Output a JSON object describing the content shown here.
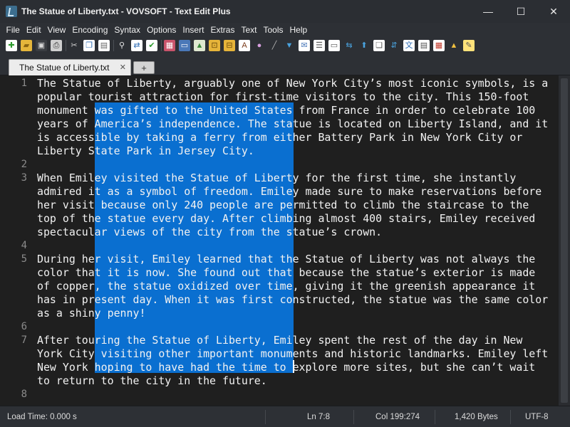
{
  "window": {
    "title": "The Statue of Liberty.txt - VOVSOFT - Text Edit Plus",
    "controls": {
      "minimize": "—",
      "maximize": "☐",
      "close": "✕"
    }
  },
  "menu": {
    "items": [
      "File",
      "Edit",
      "View",
      "Encoding",
      "Syntax",
      "Options",
      "Insert",
      "Extras",
      "Text",
      "Tools",
      "Help"
    ]
  },
  "toolbar": {
    "icons": [
      {
        "name": "new-file-icon",
        "glyph": "✚",
        "bg": "#ffffff",
        "fg": "#2e9b2e"
      },
      {
        "name": "open-folder-icon",
        "glyph": "▰",
        "bg": "#e5b63b",
        "fg": "#8a6410"
      },
      {
        "name": "save-icon",
        "glyph": "▣",
        "bg": "#3a3d42",
        "fg": "#d8d8d8"
      },
      {
        "name": "print-icon",
        "glyph": "⎙",
        "bg": "#cfcfcf",
        "fg": "#333333"
      },
      {
        "sep": true
      },
      {
        "name": "cut-icon",
        "glyph": "✂",
        "bg": "transparent",
        "fg": "#d0d0d0"
      },
      {
        "name": "copy-icon",
        "glyph": "❐",
        "bg": "#ffffff",
        "fg": "#2f6db5"
      },
      {
        "name": "paste-icon",
        "glyph": "▤",
        "bg": "#ffffff",
        "fg": "#6a6a6a"
      },
      {
        "sep": true
      },
      {
        "name": "find-icon",
        "glyph": "⚲",
        "bg": "transparent",
        "fg": "#e8e8e8"
      },
      {
        "name": "replace-icon",
        "glyph": "⇄",
        "bg": "#ffffff",
        "fg": "#2f6db5"
      },
      {
        "name": "check-icon",
        "glyph": "✔",
        "bg": "#ffffff",
        "fg": "#2e9b2e"
      },
      {
        "sep": true
      },
      {
        "name": "bookmark-icon",
        "glyph": "▦",
        "bg": "#c9546b",
        "fg": "#ffffff"
      },
      {
        "name": "monitor-icon",
        "glyph": "▭",
        "bg": "#4a78b8",
        "fg": "#ffffff"
      },
      {
        "name": "image-icon",
        "glyph": "▲",
        "bg": "#dfe8d0",
        "fg": "#3c8a3c"
      },
      {
        "name": "lock-icon",
        "glyph": "⊡",
        "bg": "#e6b43a",
        "fg": "#6b4a0a"
      },
      {
        "name": "unlock-icon",
        "glyph": "⊟",
        "bg": "#e6b43a",
        "fg": "#6b4a0a"
      },
      {
        "name": "font-icon",
        "glyph": "A",
        "bg": "#ffffff",
        "fg": "#7a3a1a"
      },
      {
        "name": "color-wheel-icon",
        "glyph": "●",
        "bg": "transparent",
        "fg": "#d9a0e0"
      },
      {
        "name": "picker-icon",
        "glyph": "╱",
        "bg": "transparent",
        "fg": "#b0b0b0"
      },
      {
        "name": "filter-icon",
        "glyph": "▼",
        "bg": "transparent",
        "fg": "#4aa3df"
      },
      {
        "name": "mail-icon",
        "glyph": "✉",
        "bg": "#ffffff",
        "fg": "#4a78b8"
      },
      {
        "name": "list-icon",
        "glyph": "☰",
        "bg": "#ffffff",
        "fg": "#555555"
      },
      {
        "name": "keyboard-icon",
        "glyph": "▭",
        "bg": "#ffffff",
        "fg": "#555555"
      },
      {
        "name": "swap-icon",
        "glyph": "⇆",
        "bg": "transparent",
        "fg": "#4aa3df"
      },
      {
        "name": "upload-icon",
        "glyph": "⬆",
        "bg": "transparent",
        "fg": "#4aa3df"
      },
      {
        "name": "copy-doc-icon",
        "glyph": "❏",
        "bg": "#ffffff",
        "fg": "#555555"
      },
      {
        "name": "sort-az-icon",
        "glyph": "⇵",
        "bg": "transparent",
        "fg": "#4aa3df"
      },
      {
        "name": "translate-icon",
        "glyph": "文",
        "bg": "#ffffff",
        "fg": "#2f6db5"
      },
      {
        "name": "table-icon",
        "glyph": "▤",
        "bg": "#ffffff",
        "fg": "#555555"
      },
      {
        "name": "calendar-icon",
        "glyph": "▦",
        "bg": "#ffffff",
        "fg": "#c0392b"
      },
      {
        "name": "warning-icon",
        "glyph": "▲",
        "bg": "transparent",
        "fg": "#f0c040"
      },
      {
        "name": "edit-note-icon",
        "glyph": "✎",
        "bg": "#ffe27a",
        "fg": "#555555"
      }
    ]
  },
  "tabs": {
    "active_label": "The Statue of Liberty.txt",
    "close_glyph": "✕",
    "add_glyph": "+"
  },
  "editor": {
    "line_numbers": [
      "1",
      "2",
      "3",
      "4",
      "5",
      "6",
      "7",
      "8"
    ],
    "visual_lines": [
      {
        "num": "1",
        "text": "The Statue of Liberty, arguably one of New York City’s most iconic symbols, is a"
      },
      {
        "num": "",
        "text": "popular tourist attraction for first-time visitors to the city. This 150-foot"
      },
      {
        "num": "",
        "text": "monument was gifted to the United States from France in order to celebrate 100"
      },
      {
        "num": "",
        "text": "years of America’s independence. The statue is located on Liberty Island, and it"
      },
      {
        "num": "",
        "text": "is accessible by taking a ferry from either Battery Park in New York City or"
      },
      {
        "num": "",
        "text": "Liberty State Park in Jersey City."
      },
      {
        "num": "2",
        "text": ""
      },
      {
        "num": "3",
        "text": "When Emiley visited the Statue of Liberty for the first time, she instantly"
      },
      {
        "num": "",
        "text": "admired it as a symbol of freedom. Emiley made sure to make reservations before"
      },
      {
        "num": "",
        "text": "her visit because only 240 people are permitted to climb the staircase to the"
      },
      {
        "num": "",
        "text": "top of the statue every day. After climbing almost 400 stairs, Emiley received"
      },
      {
        "num": "",
        "text": "spectacular views of the city from the statue’s crown."
      },
      {
        "num": "4",
        "text": ""
      },
      {
        "num": "5",
        "text": "During her visit, Emiley learned that the Statue of Liberty was not always the"
      },
      {
        "num": "",
        "text": "color that it is now. She found out that because the statue’s exterior is made"
      },
      {
        "num": "",
        "text": "of copper, the statue oxidized over time, giving it the greenish appearance it"
      },
      {
        "num": "",
        "text": "has in present day. When it was first constructed, the statue was the same color"
      },
      {
        "num": "",
        "text": "as a shiny penny!"
      },
      {
        "num": "6",
        "text": ""
      },
      {
        "num": "7",
        "text": "After touring the Statue of Liberty, Emiley spent the rest of the day in New"
      },
      {
        "num": "",
        "text": "York City visiting other important monuments and historic landmarks. Emiley left"
      },
      {
        "num": "",
        "text": "New York hoping to have had the time to explore more sites, but she can’t wait"
      },
      {
        "num": "",
        "text": "to return to the city in the future."
      },
      {
        "num": "8",
        "text": ""
      }
    ]
  },
  "status": {
    "load_time": "Load Time: 0.000 s",
    "line": "Ln 7:8",
    "column": "Col 199:274",
    "size": "1,420 Bytes",
    "encoding": "UTF-8"
  }
}
